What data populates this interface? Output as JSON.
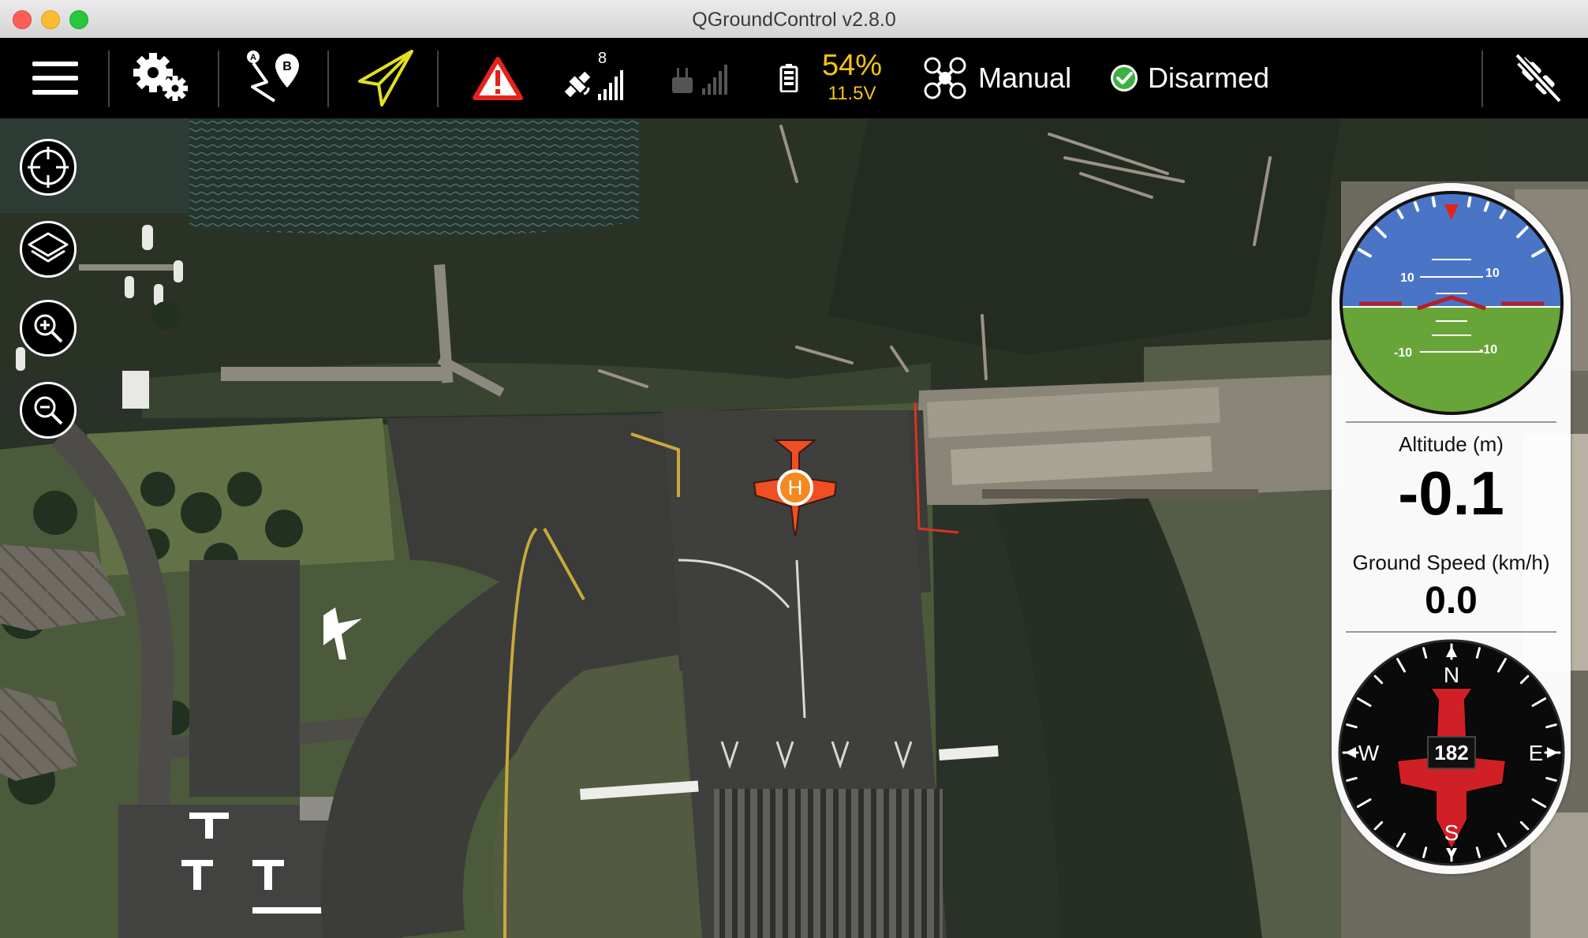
{
  "window": {
    "title": "QGroundControl v2.8.0"
  },
  "toolbar": {
    "satellite_count": "8",
    "battery_percent": "54%",
    "battery_voltage": "11.5V",
    "flight_mode": "Manual",
    "arm_status": "Disarmed",
    "colors": {
      "battery": "#f5c312",
      "plan_active": "#e3e11d",
      "warning": "#e3231b",
      "armed_ok": "#3cb043"
    }
  },
  "map_tools": [
    {
      "icon": "center-crosshair-icon"
    },
    {
      "icon": "map-layers-icon"
    },
    {
      "icon": "zoom-in-icon"
    },
    {
      "icon": "zoom-out-icon"
    }
  ],
  "vehicle": {
    "home_label": "H",
    "color": "#f04e23"
  },
  "attitude": {
    "pitch_labels": [
      "10",
      "10",
      "-10",
      "-10"
    ],
    "sky_color": "#4a74c6",
    "ground_color": "#68a538"
  },
  "instruments": {
    "altitude_label": "Altitude (m)",
    "altitude_value": "-0.1",
    "speed_label": "Ground Speed (km/h)",
    "speed_value": "0.0"
  },
  "compass": {
    "north": "N",
    "south": "S",
    "east": "E",
    "west": "W",
    "heading": "182"
  }
}
